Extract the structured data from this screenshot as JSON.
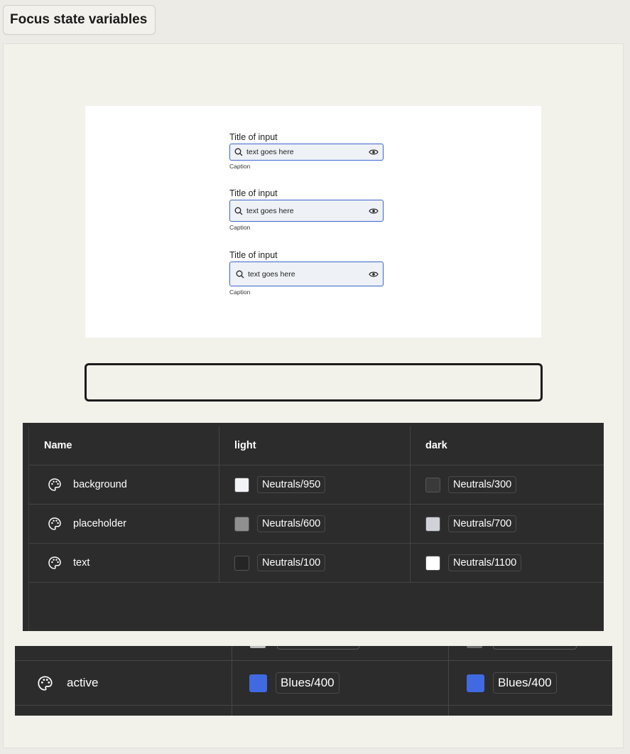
{
  "page": {
    "title": "Focus state variables"
  },
  "preview": {
    "fields": [
      {
        "title": "Title of input",
        "value": "text goes here",
        "caption": "Caption"
      },
      {
        "title": "Title of input",
        "value": "text goes here",
        "caption": "Caption"
      },
      {
        "title": "Title of input",
        "value": "text goes here",
        "caption": "Caption"
      }
    ]
  },
  "variables_table": {
    "headers": [
      "Name",
      "light",
      "dark"
    ],
    "rows": [
      {
        "name": "background",
        "icon": "palette-icon",
        "light": {
          "value": "Neutrals/950",
          "color": "#f1f3f6"
        },
        "dark": {
          "value": "Neutrals/300",
          "color": "#3a3a3a"
        }
      },
      {
        "name": "placeholder",
        "icon": "palette-icon",
        "light": {
          "value": "Neutrals/600",
          "color": "#8f8f8f"
        },
        "dark": {
          "value": "Neutrals/700",
          "color": "#cfd2d6"
        }
      },
      {
        "name": "text",
        "icon": "palette-icon",
        "light": {
          "value": "Neutrals/100",
          "color": "#252525"
        },
        "dark": {
          "value": "Neutrals/1100",
          "color": "#ffffff"
        }
      }
    ]
  },
  "active_table": {
    "row": {
      "name": "active",
      "icon": "palette-icon",
      "light": {
        "value": "Blues/400",
        "color": "#4169e1"
      },
      "dark": {
        "value": "Blues/400",
        "color": "#4169e1"
      }
    }
  }
}
